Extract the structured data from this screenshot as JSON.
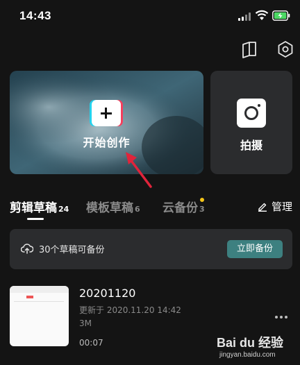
{
  "status_bar": {
    "time": "14:43"
  },
  "hero": {
    "label": "开始创作"
  },
  "camera": {
    "label": "拍摄"
  },
  "tabs": [
    {
      "label": "剪辑草稿",
      "count": "24",
      "active": true
    },
    {
      "label": "模板草稿",
      "count": "6",
      "active": false
    },
    {
      "label": "云备份",
      "count": "3",
      "active": false,
      "has_dot": true
    }
  ],
  "manage": {
    "label": "管理",
    "icon": "pencil-icon"
  },
  "backup": {
    "text": "30个草稿可备份",
    "button_label": "立即备份",
    "icon": "cloud-upload-icon"
  },
  "draft": {
    "title": "20201120",
    "updated": "更新于 2020.11.20 14:42",
    "size": "3M",
    "duration": "00:07"
  },
  "watermark": {
    "logo": "Bai du 经验",
    "url": "jingyan.baidu.com"
  },
  "colors": {
    "background": "#141414",
    "card": "#2b2c2e",
    "accent_button": "#3d8080",
    "arrow": "#e0243b",
    "dot": "#f5c518"
  }
}
